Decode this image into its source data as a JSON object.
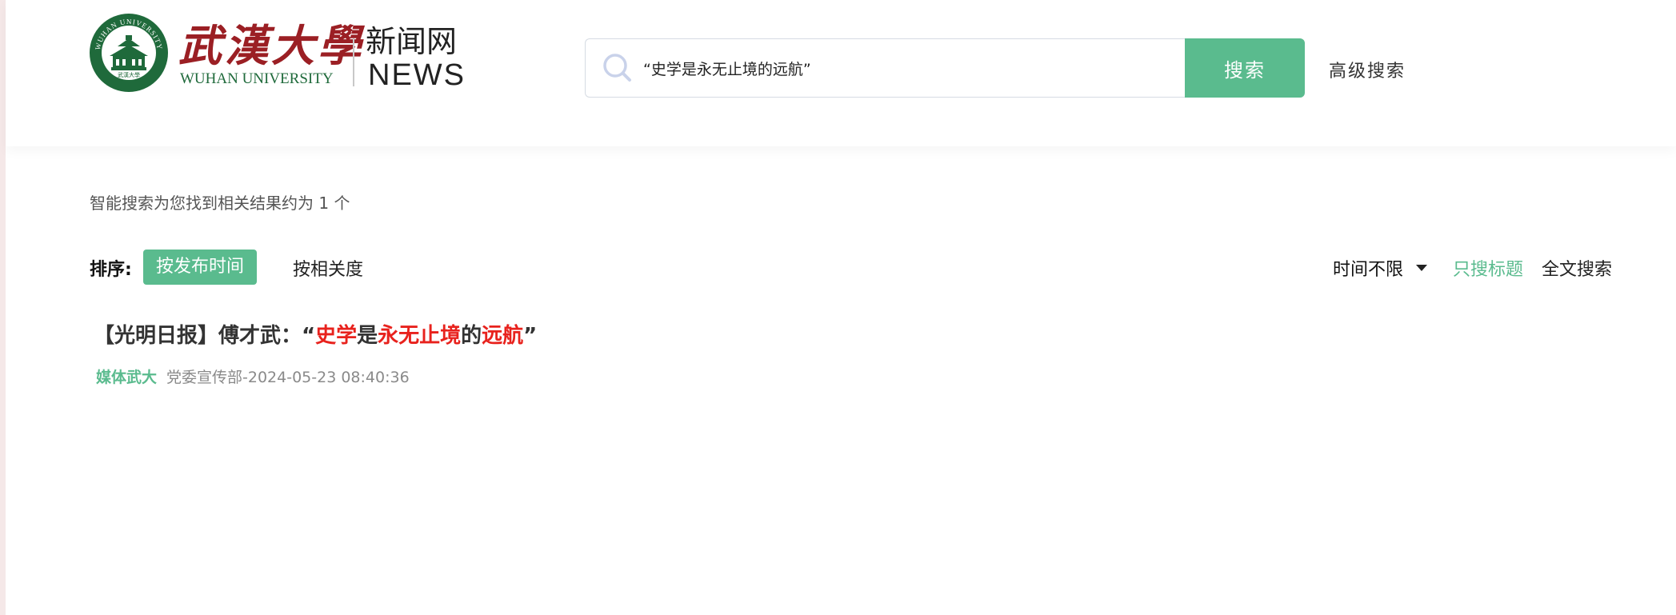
{
  "header": {
    "logo": {
      "cn_name": "武漢大學",
      "en_name": "WUHAN UNIVERSITY",
      "seal_text_top": "WUHAN UNIVERSITY",
      "seal_text_bottom": "武漢大學",
      "news_cn": "新闻网",
      "news_en": "NEWS"
    },
    "search": {
      "value": "“史学是永无止境的远航”",
      "button_label": "搜索",
      "advanced_label": "高级搜索"
    },
    "colors": {
      "accent": "#5abb8e",
      "brand_red": "#9b1f24",
      "seal_green": "#1f6a3b"
    }
  },
  "results": {
    "summary": "智能搜索为您找到相关结果约为 1 个",
    "sort": {
      "label": "排序:",
      "by_time": "按发布时间",
      "by_relevance": "按相关度",
      "active": "by_time"
    },
    "filters": {
      "time_range": "时间不限",
      "title_only": "只搜标题",
      "full_text": "全文搜索",
      "active": "title_only"
    },
    "items": [
      {
        "title_parts": [
          {
            "text": "【光明日报】傅才武：“",
            "highlight": false
          },
          {
            "text": "史学",
            "highlight": true
          },
          {
            "text": "是",
            "highlight": false
          },
          {
            "text": "永无止境",
            "highlight": true
          },
          {
            "text": "的",
            "highlight": false
          },
          {
            "text": "远航",
            "highlight": true
          },
          {
            "text": "”",
            "highlight": false
          }
        ],
        "category": "媒体武大",
        "source_date": "党委宣传部-2024-05-23 08:40:36"
      }
    ],
    "highlight_color": "#e8221d"
  }
}
